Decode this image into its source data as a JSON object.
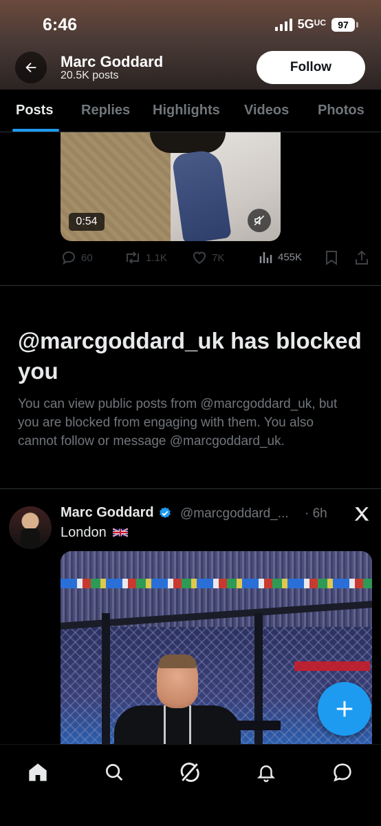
{
  "status_bar": {
    "time": "6:46",
    "network": "5G",
    "battery": "97"
  },
  "profile_header": {
    "name": "Marc Goddard",
    "posts_count": "20.5K posts",
    "follow_label": "Follow"
  },
  "tabs": [
    {
      "label": "Posts",
      "active": true
    },
    {
      "label": "Replies",
      "active": false
    },
    {
      "label": "Highlights",
      "active": false
    },
    {
      "label": "Videos",
      "active": false
    },
    {
      "label": "Photos",
      "active": false
    }
  ],
  "video_post": {
    "duration": "0:54",
    "replies": "60",
    "reposts": "1.1K",
    "likes": "7K",
    "views": "455K"
  },
  "blocked_notice": {
    "title": "@marcgoddard_uk has blocked you",
    "description": "You can view public posts from @marcgoddard_uk, but you are blocked from engaging with them. You also cannot follow or message @marcgoddard_uk."
  },
  "second_post": {
    "author": "Marc Goddard",
    "handle": "@marcgoddard_...",
    "time": "· 6h",
    "text": "London",
    "flag_icon": "uk-flag-icon"
  },
  "bottom_nav": [
    {
      "icon": "home-icon"
    },
    {
      "icon": "search-icon"
    },
    {
      "icon": "grok-icon"
    },
    {
      "icon": "notifications-icon"
    },
    {
      "icon": "messages-icon"
    }
  ],
  "colors": {
    "accent": "#1d9bf0",
    "text_primary": "#e7e9ea",
    "text_secondary": "#71767b",
    "divider": "#2f3336"
  }
}
